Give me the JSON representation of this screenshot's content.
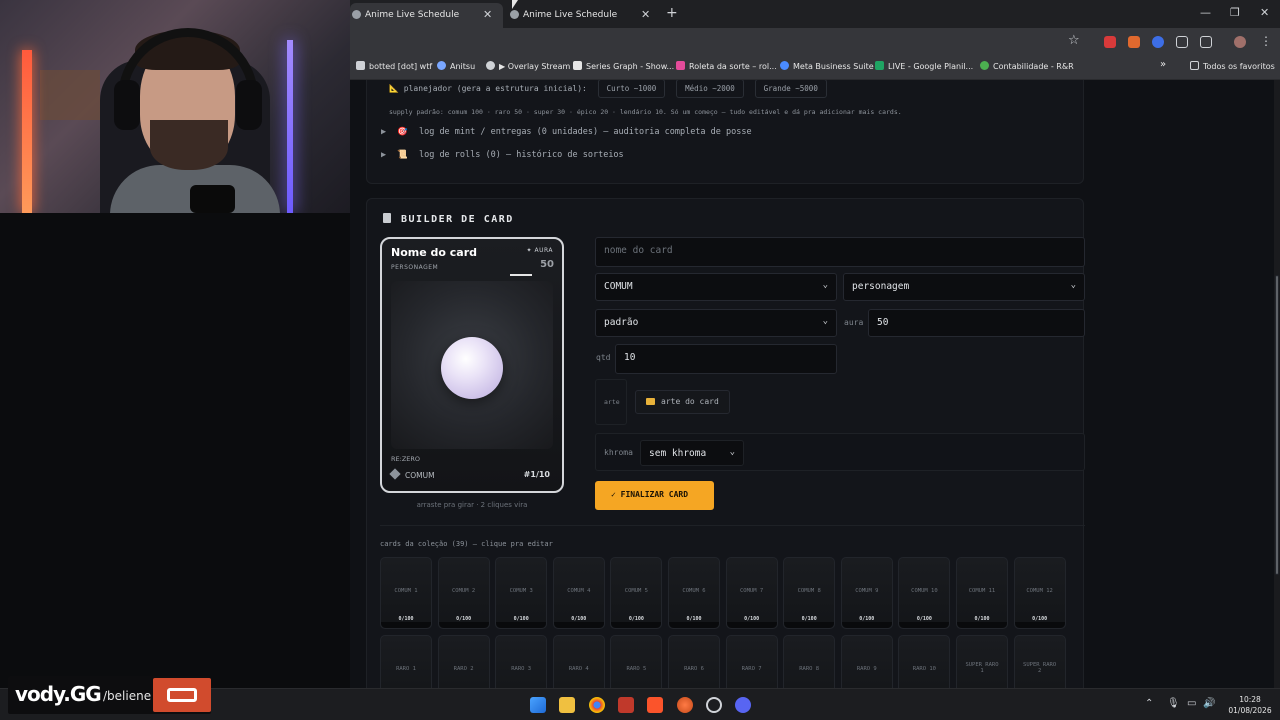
{
  "browser": {
    "tabs": [
      {
        "label": "Anime Live Schedule",
        "active": true
      },
      {
        "label": "Anime Live Schedule",
        "active": false
      }
    ],
    "new_tab": "+",
    "window_controls": [
      "—",
      "❐",
      "✕"
    ],
    "bookmarks": [
      {
        "label": "botted [dot] wtf",
        "color": "#cfd2d6"
      },
      {
        "label": "Anitsu",
        "color": "#7aa7ff"
      },
      {
        "label": "▶ Overlay Stream",
        "color": "#cfd2d6"
      },
      {
        "label": "Series Graph - Show...",
        "color": "#e6e6e6"
      },
      {
        "label": "Roleta da sorte – rol...",
        "color": "#e44b9a"
      },
      {
        "label": "Meta Business Suite",
        "color": "#4a8bff"
      },
      {
        "label": "LIVE - Google Planil...",
        "color": "#1fa463"
      },
      {
        "label": "Contabilidade - R&R",
        "color": "#4caf50"
      }
    ],
    "bookmarks_more": "»",
    "all_favorites": "Todos os favoritos"
  },
  "top_panel": {
    "planner_label": "planejador (gera a estrutura inicial):",
    "planner_options": [
      "Curto ~1000",
      "Médio ~2000",
      "Grande ~5000"
    ],
    "supply_text": "supply padrão: comum 100 · raro 50 · super 30 · épico 20 · lendário 10. Só um começo — tudo editável e dá pra adicionar mais cards.",
    "logs": [
      {
        "icon": "🎯",
        "label": "log de mint / entregas (0 unidades) — auditoria completa de posse"
      },
      {
        "icon": "📜",
        "label": "log de rolls (0) — histórico de sorteios"
      }
    ]
  },
  "builder": {
    "title": "BUILDER DE CARD",
    "card": {
      "name": "Nome do card",
      "type": "PERSONAGEM",
      "aura_label": "✦ AURA",
      "aura_value": "50",
      "series": "RE:ZERO",
      "rarity": "COMUM",
      "serial": "#1/10"
    },
    "card_hint": "arraste pra girar · 2 cliques vira",
    "name_placeholder": "nome do card",
    "rarity_select": "COMUM",
    "type_select": "personagem",
    "style_select": "padrão",
    "aura_label": "aura",
    "aura_value": "50",
    "qty_label": "qtd",
    "qty_value": "10",
    "art_label": "arte",
    "art_button": "arte do card",
    "khroma_label": "khroma",
    "khroma_select": "sem khroma",
    "finalize_button": "✓ FINALIZAR CARD",
    "collection_title": "cards da coleção (39) — clique pra editar",
    "collection_row1": [
      {
        "name": "COMUM 1",
        "count": "0/100"
      },
      {
        "name": "COMUM 2",
        "count": "0/100"
      },
      {
        "name": "COMUM 3",
        "count": "0/100"
      },
      {
        "name": "COMUM 4",
        "count": "0/100"
      },
      {
        "name": "COMUM 5",
        "count": "0/100"
      },
      {
        "name": "COMUM 6",
        "count": "0/100"
      },
      {
        "name": "COMUM 7",
        "count": "0/100"
      },
      {
        "name": "COMUM 8",
        "count": "0/100"
      },
      {
        "name": "COMUM 9",
        "count": "0/100"
      },
      {
        "name": "COMUM 10",
        "count": "0/100"
      },
      {
        "name": "COMUM 11",
        "count": "0/100"
      },
      {
        "name": "COMUM 12",
        "count": "0/100"
      }
    ],
    "collection_row2": [
      {
        "name": "RARO 1"
      },
      {
        "name": "RARO 2"
      },
      {
        "name": "RARO 3"
      },
      {
        "name": "RARO 4"
      },
      {
        "name": "RARO 5"
      },
      {
        "name": "RARO 6"
      },
      {
        "name": "RARO 7"
      },
      {
        "name": "RARO 8"
      },
      {
        "name": "RARO 9"
      },
      {
        "name": "RARO 10"
      },
      {
        "name": "SUPER RARO 1"
      },
      {
        "name": "SUPER RARO 2"
      }
    ]
  },
  "overlay": {
    "brand": "vody.GG",
    "handle": "/beliene"
  },
  "taskbar": {
    "time": "10:28",
    "date": "01/08/2026"
  },
  "colors": {
    "accent": "#f5a623",
    "page_bg": "#0f1115",
    "panel_bg": "#13151a"
  }
}
